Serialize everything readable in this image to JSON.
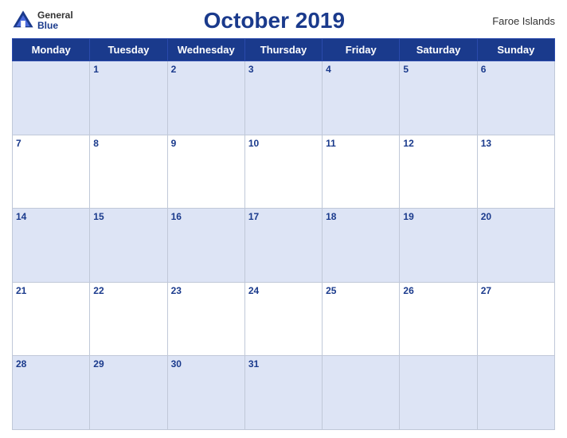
{
  "header": {
    "logo_general": "General",
    "logo_blue": "Blue",
    "title": "October 2019",
    "region": "Faroe Islands"
  },
  "weekdays": [
    "Monday",
    "Tuesday",
    "Wednesday",
    "Thursday",
    "Friday",
    "Saturday",
    "Sunday"
  ],
  "weeks": [
    [
      "",
      "1",
      "2",
      "3",
      "4",
      "5",
      "6"
    ],
    [
      "7",
      "8",
      "9",
      "10",
      "11",
      "12",
      "13"
    ],
    [
      "14",
      "15",
      "16",
      "17",
      "18",
      "19",
      "20"
    ],
    [
      "21",
      "22",
      "23",
      "24",
      "25",
      "26",
      "27"
    ],
    [
      "28",
      "29",
      "30",
      "31",
      "",
      "",
      ""
    ]
  ]
}
